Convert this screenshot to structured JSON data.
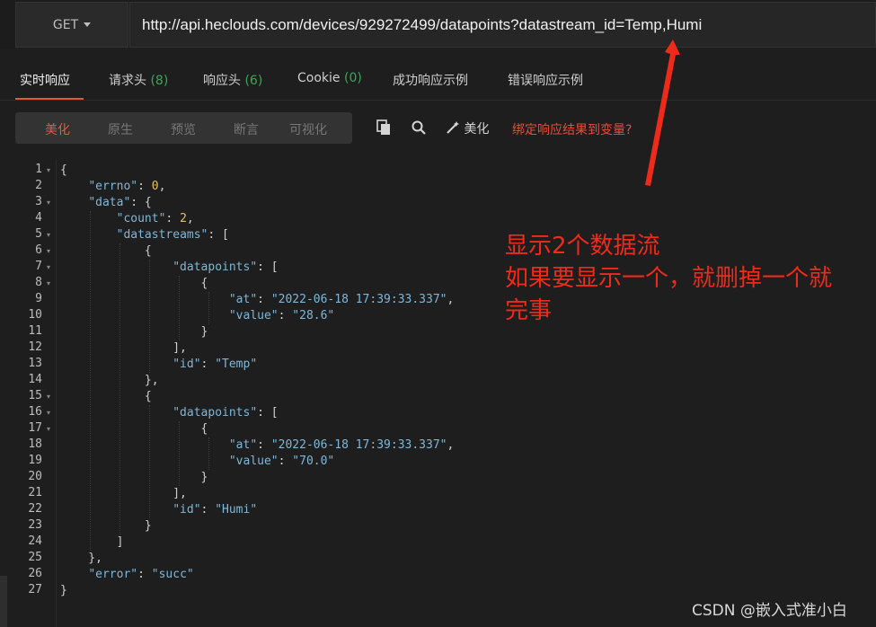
{
  "request": {
    "method": "GET",
    "url": "http://api.heclouds.com/devices/929272499/datapoints?datastream_id=Temp,Humi"
  },
  "tabs": [
    {
      "label": "实时响应",
      "count": ""
    },
    {
      "label": "请求头",
      "count": "(8)"
    },
    {
      "label": "响应头",
      "count": "(6)"
    },
    {
      "label": "Cookie",
      "count": "(0)"
    },
    {
      "label": "成功响应示例",
      "count": ""
    },
    {
      "label": "错误响应示例",
      "count": ""
    }
  ],
  "view_modes": [
    "美化",
    "原生",
    "预览",
    "断言",
    "可视化"
  ],
  "toolbar": {
    "beautify_label": "美化",
    "bind_hint": "绑定响应结果到变量?",
    "copy_icon": "copy-icon",
    "search_icon": "search-icon",
    "wand_icon": "magic-wand-icon"
  },
  "code_lines": [
    {
      "n": "1",
      "t": "{"
    },
    {
      "n": "2",
      "t": "    \"errno\": 0,"
    },
    {
      "n": "3",
      "t": "    \"data\": {"
    },
    {
      "n": "4",
      "t": "        \"count\": 2,"
    },
    {
      "n": "5",
      "t": "        \"datastreams\": ["
    },
    {
      "n": "6",
      "t": "            {"
    },
    {
      "n": "7",
      "t": "                \"datapoints\": ["
    },
    {
      "n": "8",
      "t": "                    {"
    },
    {
      "n": "9",
      "t": "                        \"at\": \"2022-06-18 17:39:33.337\","
    },
    {
      "n": "10",
      "t": "                        \"value\": \"28.6\""
    },
    {
      "n": "11",
      "t": "                    }"
    },
    {
      "n": "12",
      "t": "                ],"
    },
    {
      "n": "13",
      "t": "                \"id\": \"Temp\""
    },
    {
      "n": "14",
      "t": "            },"
    },
    {
      "n": "15",
      "t": "            {"
    },
    {
      "n": "16",
      "t": "                \"datapoints\": ["
    },
    {
      "n": "17",
      "t": "                    {"
    },
    {
      "n": "18",
      "t": "                        \"at\": \"2022-06-18 17:39:33.337\","
    },
    {
      "n": "19",
      "t": "                        \"value\": \"70.0\""
    },
    {
      "n": "20",
      "t": "                    }"
    },
    {
      "n": "21",
      "t": "                ],"
    },
    {
      "n": "22",
      "t": "                \"id\": \"Humi\""
    },
    {
      "n": "23",
      "t": "            }"
    },
    {
      "n": "24",
      "t": "        ]"
    },
    {
      "n": "25",
      "t": "    },"
    },
    {
      "n": "26",
      "t": "    \"error\": \"succ\""
    },
    {
      "n": "27",
      "t": "}"
    }
  ],
  "fold_lines": [
    "1",
    "3",
    "5",
    "6",
    "7",
    "8",
    "15",
    "16",
    "17"
  ],
  "annotation": {
    "line1": "显示2个数据流",
    "line2": "如果要显示一个，就删掉一个就",
    "line3": "完事",
    "color": "#ee2a1a"
  },
  "watermark": "CSDN @嵌入式准小白",
  "colors": {
    "accent": "#e8563e",
    "count_green": "#3fa55b",
    "json_key": "#7fb7d9",
    "json_number": "#e8c06a"
  }
}
